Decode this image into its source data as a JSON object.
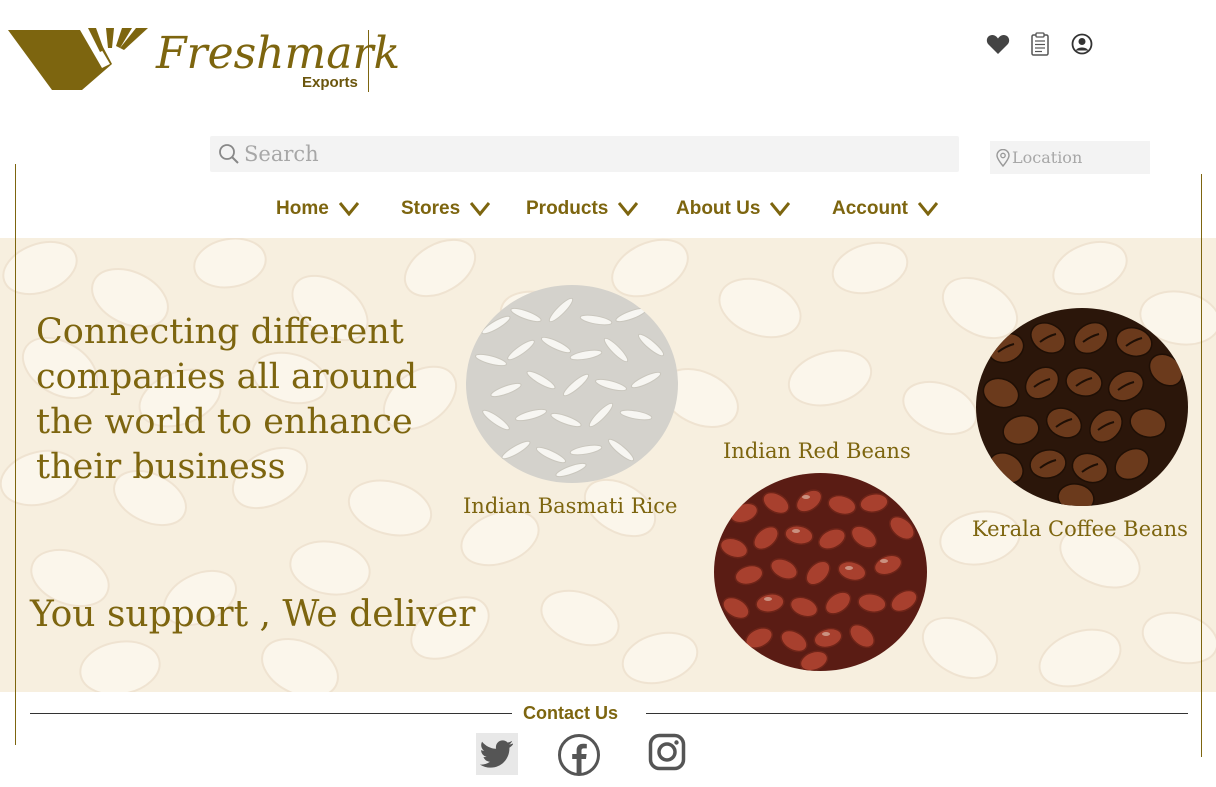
{
  "brand": {
    "name": "Freshmark",
    "sub": "Exports"
  },
  "header_icons": [
    "heart-icon",
    "clipboard-icon",
    "user-icon"
  ],
  "search": {
    "placeholder": "Search"
  },
  "location": {
    "placeholder": "Location"
  },
  "nav": [
    {
      "label": "Home"
    },
    {
      "label": "Stores"
    },
    {
      "label": "Products"
    },
    {
      "label": "About Us"
    },
    {
      "label": "Account"
    }
  ],
  "hero": {
    "tagline": "Connecting different companies all around the world to enhance their business",
    "slogan": "You support , We deliver"
  },
  "products": [
    {
      "label": "Indian Basmati Rice"
    },
    {
      "label": "Indian Red Beans"
    },
    {
      "label": "Kerala Coffee Beans"
    }
  ],
  "footer": {
    "contact_title": "Contact Us",
    "social": [
      "twitter-icon",
      "facebook-icon",
      "instagram-icon"
    ]
  },
  "colors": {
    "accent": "#7d650f",
    "hero_bg": "#f2e3c8"
  }
}
